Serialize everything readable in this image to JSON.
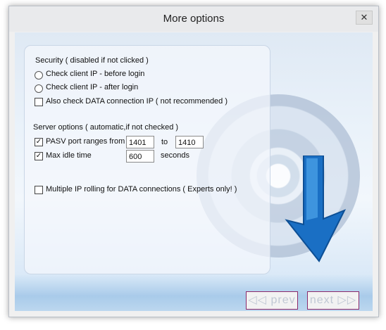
{
  "window": {
    "title": "More options",
    "close_glyph": "✕"
  },
  "security": {
    "heading": "Security ( disabled if not clicked )",
    "before_login": "Check client IP - before login",
    "after_login": "Check client IP - after login",
    "data_conn": "Also check DATA connection IP ( not recommended )",
    "data_conn_checked": false
  },
  "server": {
    "heading": "Server options ( automatic,if not checked )",
    "pasv_label": "PASV port ranges from",
    "pasv_checked": true,
    "pasv_from": "1401",
    "to_label": "to",
    "pasv_to": "1410",
    "idle_label": "Max idle time",
    "idle_checked": true,
    "idle_value": "600",
    "seconds_label": "seconds"
  },
  "rolling": {
    "label": "Multiple IP rolling for DATA connections ( Experts only! )",
    "checked": false
  },
  "nav": {
    "prev_label": "◁◁ prev",
    "next_label": "next ▷▷"
  },
  "colors": {
    "nav_border": "#8b2a6b",
    "accent": "#1a6fc4"
  }
}
